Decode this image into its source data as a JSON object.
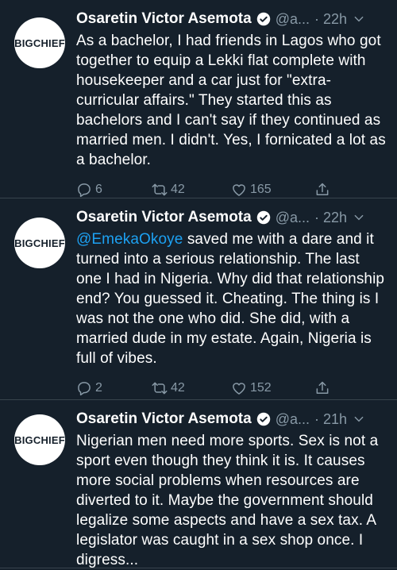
{
  "tweets": [
    {
      "name": "Osaretin Victor Asemota",
      "handle": "@a...",
      "time": "· 22h",
      "avatar_text": "BIGCHIEF",
      "body": "As a bachelor, I had friends in Lagos who got together to equip a Lekki flat complete with housekeeper and a car just for \"extra-curricular affairs.\" They started this as bachelors and I can't say if they continued as married men. I didn't. Yes, I fornicated a lot as a bachelor.",
      "replies": "6",
      "retweets": "42",
      "likes": "165"
    },
    {
      "name": "Osaretin Victor Asemota",
      "handle": "@a...",
      "time": "· 22h",
      "avatar_text": "BIGCHIEF",
      "mention": "@EmekaOkoye",
      "body": " saved me with a dare and it turned into a serious relationship. The last one I had in Nigeria. Why did that relationship end? You guessed it. Cheating. The thing is I was not the one who did. She did, with a married dude in my estate. Again, Nigeria is full of vibes.",
      "replies": "2",
      "retweets": "42",
      "likes": "152"
    },
    {
      "name": "Osaretin Victor Asemota",
      "handle": "@a...",
      "time": "· 21h",
      "avatar_text": "BIGCHIEF",
      "body": "Nigerian men need more sports. Sex is not a sport even though they think it is. It causes more social problems when resources are diverted to it. Maybe the government should legalize some aspects and have a sex tax. A legislator was caught in a sex shop once. I digress..."
    }
  ],
  "colors": {
    "background": "#15202b",
    "text": "#ffffff",
    "muted": "#8899a6",
    "link": "#1da1f2",
    "divider": "#38444d"
  },
  "icons": [
    "verified-badge-icon",
    "chevron-down-icon",
    "reply-icon",
    "retweet-icon",
    "like-icon",
    "share-icon"
  ]
}
